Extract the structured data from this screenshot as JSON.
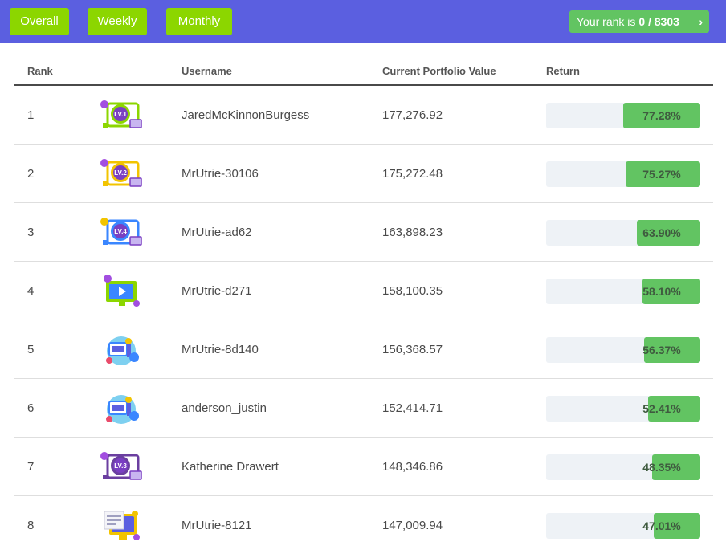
{
  "tabs": [
    "Overall",
    "Weekly",
    "Monthly"
  ],
  "rank_pill": {
    "prefix": "Your rank is ",
    "value": "0 / 8303"
  },
  "headers": {
    "rank": "Rank",
    "username": "Username",
    "value": "Current Portfolio Value",
    "return": "Return"
  },
  "colors": {
    "accent": "#5b5fe0",
    "tab": "#8cd600",
    "positive": "#62c462",
    "track": "#eef2f6"
  },
  "rows": [
    {
      "rank": "1",
      "username": "JaredMcKinnonBurgess",
      "value": "177,276.92",
      "return_label": "77.28%",
      "badge": "level-1-badge-icon"
    },
    {
      "rank": "2",
      "username": "MrUtrie-30106",
      "value": "175,272.48",
      "return_label": "75.27%",
      "badge": "level-2-badge-icon"
    },
    {
      "rank": "3",
      "username": "MrUtrie-ad62",
      "value": "163,898.23",
      "return_label": "63.90%",
      "badge": "level-4-badge-icon"
    },
    {
      "rank": "4",
      "username": "MrUtrie-d271",
      "value": "158,100.35",
      "return_label": "58.10%",
      "badge": "monitor-badge-icon"
    },
    {
      "rank": "5",
      "username": "MrUtrie-8d140",
      "value": "156,368.57",
      "return_label": "56.37%",
      "badge": "globe-badge-icon"
    },
    {
      "rank": "6",
      "username": "anderson_justin",
      "value": "152,414.71",
      "return_label": "52.41%",
      "badge": "globe-badge-icon"
    },
    {
      "rank": "7",
      "username": "Katherine Drawert",
      "value": "148,346.86",
      "return_label": "48.35%",
      "badge": "level-3-badge-icon"
    },
    {
      "rank": "8",
      "username": "MrUtrie-8121",
      "value": "147,009.94",
      "return_label": "47.01%",
      "badge": "computer-badge-icon"
    }
  ]
}
